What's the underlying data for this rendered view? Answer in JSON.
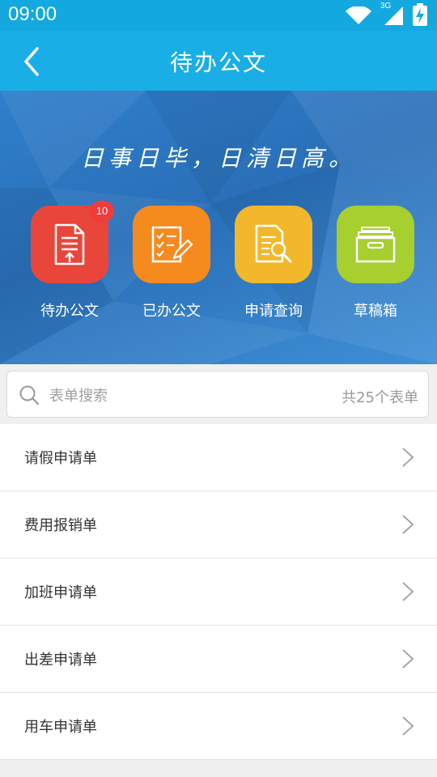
{
  "status_bar": {
    "time": "09:00",
    "network_label": "3G",
    "icons": [
      "wifi-icon",
      "cellular-signal-icon",
      "battery-charging-icon"
    ]
  },
  "app_bar": {
    "title": "待办公文",
    "back_icon": "chevron-left-icon"
  },
  "banner": {
    "slogan": "日事日毕，日清日高。",
    "tiles": [
      {
        "label": "待办公文",
        "icon": "document-upload-icon",
        "color": "#e8463b",
        "badge": "10"
      },
      {
        "label": "已办公文",
        "icon": "checklist-edit-icon",
        "color": "#f58a1f"
      },
      {
        "label": "申请查询",
        "icon": "document-search-icon",
        "color": "#f2b72b"
      },
      {
        "label": "草稿箱",
        "icon": "archive-box-icon",
        "color": "#a6cf2f"
      }
    ]
  },
  "search": {
    "placeholder": "表单搜索",
    "value": "",
    "count_text": "共25个表单"
  },
  "forms": [
    {
      "label": "请假申请单"
    },
    {
      "label": "费用报销单"
    },
    {
      "label": "加班申请单"
    },
    {
      "label": "出差申请单"
    },
    {
      "label": "用车申请单"
    }
  ],
  "colors": {
    "status_bar": "#13a8e0",
    "app_bar": "#1aaee7",
    "banner": "#2f7fcb",
    "badge": "#f23b3b"
  }
}
